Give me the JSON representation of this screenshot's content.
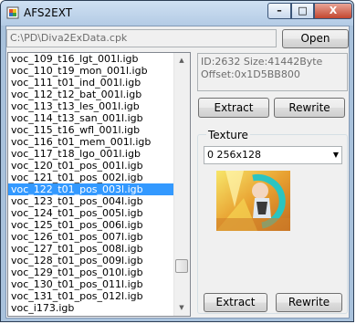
{
  "window": {
    "title": "AFS2EXT",
    "minimize_label": "–",
    "maximize_label": "□",
    "close_label": "X"
  },
  "file": {
    "path": "C:\\PD\\Diva2ExData.cpk",
    "open_label": "Open"
  },
  "entries": [
    {
      "name": "voc_109_t16_lgt_001l.igb",
      "selected": false
    },
    {
      "name": "voc_110_t19_mon_001l.igb",
      "selected": false
    },
    {
      "name": "voc_111_t01_ind_001l.igb",
      "selected": false
    },
    {
      "name": "voc_112_t12_bat_001l.igb",
      "selected": false
    },
    {
      "name": "voc_113_t13_les_001l.igb",
      "selected": false
    },
    {
      "name": "voc_114_t13_san_001l.igb",
      "selected": false
    },
    {
      "name": "voc_115_t16_wfl_001l.igb",
      "selected": false
    },
    {
      "name": "voc_116_t01_mem_001l.igb",
      "selected": false
    },
    {
      "name": "voc_117_t18_lgo_001l.igb",
      "selected": false
    },
    {
      "name": "voc_120_t01_pos_001l.igb",
      "selected": false
    },
    {
      "name": "voc_121_t01_pos_002l.igb",
      "selected": false
    },
    {
      "name": "voc_122_t01_pos_003l.igb",
      "selected": true
    },
    {
      "name": "voc_123_t01_pos_004l.igb",
      "selected": false
    },
    {
      "name": "voc_124_t01_pos_005l.igb",
      "selected": false
    },
    {
      "name": "voc_125_t01_pos_006l.igb",
      "selected": false
    },
    {
      "name": "voc_126_t01_pos_007l.igb",
      "selected": false
    },
    {
      "name": "voc_127_t01_pos_008l.igb",
      "selected": false
    },
    {
      "name": "voc_128_t01_pos_009l.igb",
      "selected": false
    },
    {
      "name": "voc_129_t01_pos_010l.igb",
      "selected": false
    },
    {
      "name": "voc_130_t01_pos_011l.igb",
      "selected": false
    },
    {
      "name": "voc_131_t01_pos_012l.igb",
      "selected": false
    },
    {
      "name": "voc_i173.igb",
      "selected": false
    }
  ],
  "entry_info": {
    "line1": "ID:2632 Size:41442Byte",
    "line2": "Offset:0x1D5BB800"
  },
  "entry_actions": {
    "extract_label": "Extract",
    "rewrite_label": "Rewrite"
  },
  "texture": {
    "group_label": "Texture",
    "selected": "0 256x128",
    "extract_label": "Extract",
    "rewrite_label": "Rewrite"
  },
  "icons": {
    "app": "app-icon",
    "scroll_up": "scroll-up-arrow-icon",
    "scroll_down": "scroll-down-arrow-icon",
    "dropdown": "chevron-down-icon"
  },
  "colors": {
    "selection": "#3399ff",
    "frame": "#a9c2dc",
    "close_button": "#c3462f"
  }
}
